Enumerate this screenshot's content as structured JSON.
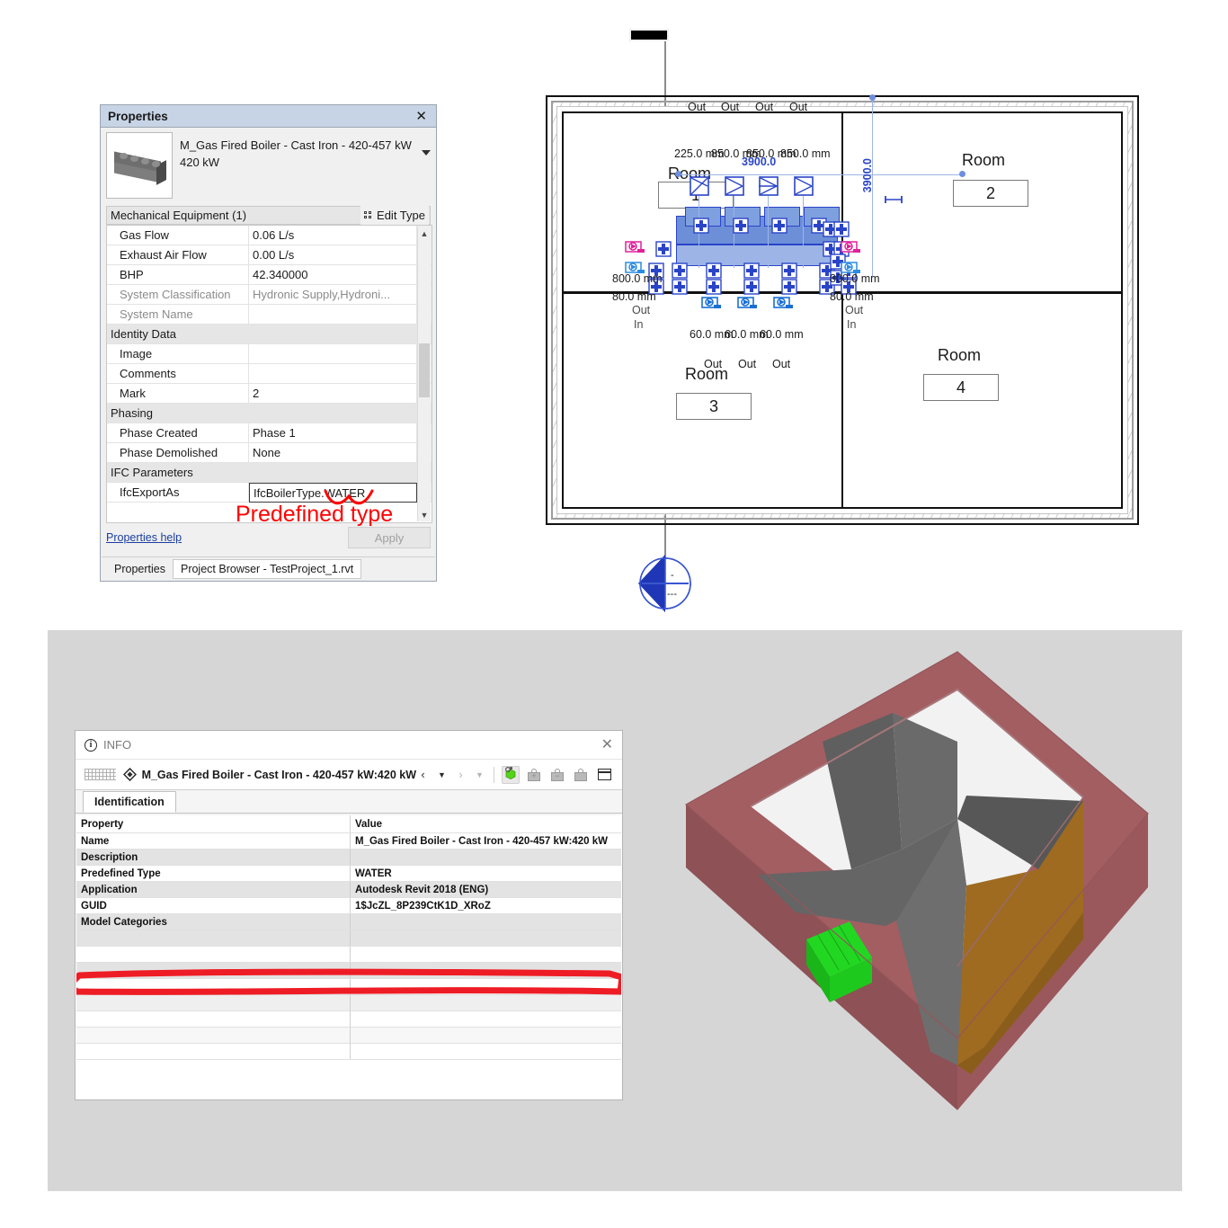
{
  "properties_palette": {
    "title": "Properties",
    "close_label": "✕",
    "type_selector": {
      "family_type": "M_Gas Fired Boiler - Cast Iron - 420-457 kW",
      "size": "420 kW",
      "thumbnail_icon": "boiler-thumbnail"
    },
    "category": "Mechanical Equipment (1)",
    "edit_type_label": "Edit Type",
    "parameters": [
      {
        "kind": "param",
        "name": "Gas Flow",
        "value": "0.06 L/s",
        "dim": false
      },
      {
        "kind": "param",
        "name": "Exhaust Air Flow",
        "value": "0.00 L/s",
        "dim": false
      },
      {
        "kind": "param",
        "name": "BHP",
        "value": "42.340000",
        "dim": false
      },
      {
        "kind": "param",
        "name": "System Classification",
        "value": "Hydronic Supply,Hydroni...",
        "dim": true
      },
      {
        "kind": "param",
        "name": "System Name",
        "value": "",
        "dim": true
      },
      {
        "kind": "group",
        "name": "Identity Data"
      },
      {
        "kind": "param",
        "name": "Image",
        "value": "",
        "dim": false
      },
      {
        "kind": "param",
        "name": "Comments",
        "value": "",
        "dim": false
      },
      {
        "kind": "param",
        "name": "Mark",
        "value": "2",
        "dim": false
      },
      {
        "kind": "group",
        "name": "Phasing"
      },
      {
        "kind": "param",
        "name": "Phase Created",
        "value": "Phase 1",
        "dim": false
      },
      {
        "kind": "param",
        "name": "Phase Demolished",
        "value": "None",
        "dim": false
      },
      {
        "kind": "group",
        "name": "IFC Parameters"
      },
      {
        "kind": "param",
        "name": "IfcExportAs",
        "value": "IfcBoilerType.WATER",
        "dim": false,
        "edited": true
      }
    ],
    "help_link": "Properties help",
    "apply_label": "Apply",
    "tabs": [
      {
        "label": "Properties",
        "selected": true
      },
      {
        "label": "Project Browser - TestProject_1.rvt",
        "selected": false
      }
    ],
    "annotation": {
      "text": "Predefined type",
      "color": "#ff0000"
    }
  },
  "floor_plan": {
    "rooms": [
      {
        "name": "Room",
        "number": "1"
      },
      {
        "name": "Room",
        "number": "2"
      },
      {
        "name": "Room",
        "number": "3"
      },
      {
        "name": "Room",
        "number": "4"
      }
    ],
    "dimensions": {
      "top_chain": [
        "225.0 mm",
        "850.0 mm",
        "850.0 mm",
        "850.0 mm"
      ],
      "overall_horizontal": "3900.0",
      "overall_vertical": "3900.0",
      "left_labels": [
        "800.0 mm",
        "80.0 mm"
      ],
      "right_labels": [
        "800.0 mm",
        "80.0 mm"
      ],
      "duct_labels": [
        "60.0 mm",
        "60.0 mm",
        "60.0 mm"
      ]
    },
    "connector_labels_top": [
      "Out",
      "Out",
      "Out",
      "Out"
    ],
    "connector_labels_mid": [
      "Out",
      "Out",
      "Out"
    ],
    "connector_labels_left": [
      "Out",
      "In"
    ],
    "connector_labels_right": [
      "Out",
      "In"
    ],
    "section_marker": {
      "top_label": "-",
      "bottom_label": "---"
    }
  },
  "info_dialog": {
    "title": "INFO",
    "title_icon": "info-circle-icon",
    "close_label": "✕",
    "object_icon": "ifc-object-icon",
    "object_name": "M_Gas Fired Boiler - Cast Iron - 420-457 kW:420 kW",
    "toolbar": [
      {
        "name": "prev-button",
        "glyph": "‹",
        "disabled": false
      },
      {
        "name": "prev-dropdown",
        "glyph": "▼",
        "disabled": false
      },
      {
        "name": "next-button",
        "glyph": "›",
        "disabled": true
      },
      {
        "name": "next-dropdown",
        "glyph": "▼",
        "disabled": true
      },
      {
        "name": "select-object-button",
        "glyph": "cube-icon",
        "disabled": false,
        "active": true
      },
      {
        "name": "add-to-selection-button",
        "glyph": "bag-plus-icon",
        "disabled": true
      },
      {
        "name": "remove-from-selection-button",
        "glyph": "bag-minus-icon",
        "disabled": true
      },
      {
        "name": "replace-selection-button",
        "glyph": "bag-icon",
        "disabled": true
      },
      {
        "name": "layout-button",
        "glyph": "window-icon",
        "disabled": false
      }
    ],
    "tabs": [
      {
        "label": "Identification",
        "selected": true
      }
    ],
    "table": {
      "headers": [
        "Property",
        "Value"
      ],
      "rows": [
        {
          "property": "Name",
          "value": "M_Gas Fired Boiler - Cast Iron - 420-457 kW:420 kW"
        },
        {
          "property": "Description",
          "value": ""
        },
        {
          "property": "Predefined Type",
          "value": "WATER",
          "highlighted": true
        },
        {
          "property": "Application",
          "value": "Autodesk Revit 2018 (ENG)"
        },
        {
          "property": "GUID",
          "value": "1$JcZL_8P239CtK1D_XRoZ"
        },
        {
          "property": "Model Categories",
          "value": ""
        }
      ]
    },
    "annotation_color": "#ee1c25"
  },
  "view_3d": {
    "name": "3d-building-model",
    "colors": {
      "walls": "#a35e62",
      "walls_shade": "#8e5155",
      "walls_light": "#b07276",
      "roof_gray": "#5f5f5f",
      "roof_gray_light": "#6e6e6e",
      "floor_brown": "#9e6b20",
      "boiler_green": "#22d722",
      "floor_white": "#f2f2f2",
      "background": "#d6d6d6"
    }
  }
}
